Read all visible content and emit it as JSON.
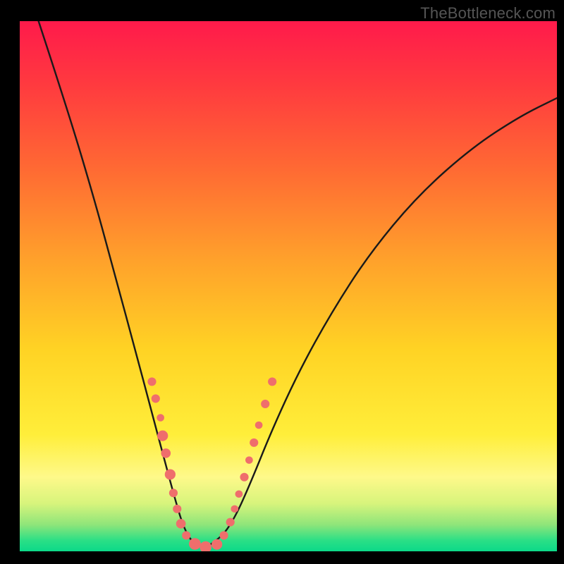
{
  "watermark": "TheBottleneck.com",
  "colors": {
    "dot_fill": "#ef6e6c",
    "curve_stroke": "#1a1a1a",
    "background_black": "#000000"
  },
  "chart_data": {
    "type": "line",
    "title": "",
    "xlabel": "",
    "ylabel": "",
    "xlim": [
      0,
      1
    ],
    "ylim": [
      0,
      1
    ],
    "note": "No axes, ticks, or numeric labels are visible. The plot shows two converging curves (a V-shaped bottleneck profile) over a vertical red→green gradient. Coordinates below are normalized to the visible plot area (0,0 = top-left, 1,1 = bottom-right).",
    "series": [
      {
        "name": "left-curve",
        "values": [
          {
            "x": 0.035,
            "y": 0.0
          },
          {
            "x": 0.09,
            "y": 0.17
          },
          {
            "x": 0.14,
            "y": 0.34
          },
          {
            "x": 0.18,
            "y": 0.49
          },
          {
            "x": 0.215,
            "y": 0.62
          },
          {
            "x": 0.245,
            "y": 0.735
          },
          {
            "x": 0.27,
            "y": 0.83
          },
          {
            "x": 0.29,
            "y": 0.905
          },
          {
            "x": 0.305,
            "y": 0.955
          },
          {
            "x": 0.322,
            "y": 0.985
          },
          {
            "x": 0.345,
            "y": 0.993
          }
        ]
      },
      {
        "name": "right-curve",
        "values": [
          {
            "x": 0.345,
            "y": 0.993
          },
          {
            "x": 0.372,
            "y": 0.978
          },
          {
            "x": 0.4,
            "y": 0.938
          },
          {
            "x": 0.43,
            "y": 0.87
          },
          {
            "x": 0.47,
            "y": 0.77
          },
          {
            "x": 0.52,
            "y": 0.66
          },
          {
            "x": 0.58,
            "y": 0.55
          },
          {
            "x": 0.65,
            "y": 0.44
          },
          {
            "x": 0.74,
            "y": 0.33
          },
          {
            "x": 0.84,
            "y": 0.24
          },
          {
            "x": 0.93,
            "y": 0.18
          },
          {
            "x": 1.0,
            "y": 0.145
          }
        ]
      }
    ],
    "points": [
      {
        "x": 0.246,
        "y": 0.68,
        "r": 8
      },
      {
        "x": 0.253,
        "y": 0.712,
        "r": 8
      },
      {
        "x": 0.262,
        "y": 0.748,
        "r": 7
      },
      {
        "x": 0.266,
        "y": 0.782,
        "r": 10
      },
      {
        "x": 0.272,
        "y": 0.815,
        "r": 9
      },
      {
        "x": 0.28,
        "y": 0.855,
        "r": 10
      },
      {
        "x": 0.286,
        "y": 0.89,
        "r": 8
      },
      {
        "x": 0.293,
        "y": 0.92,
        "r": 8
      },
      {
        "x": 0.3,
        "y": 0.948,
        "r": 9
      },
      {
        "x": 0.31,
        "y": 0.97,
        "r": 8
      },
      {
        "x": 0.326,
        "y": 0.986,
        "r": 11
      },
      {
        "x": 0.346,
        "y": 0.992,
        "r": 11
      },
      {
        "x": 0.367,
        "y": 0.987,
        "r": 10
      },
      {
        "x": 0.38,
        "y": 0.97,
        "r": 8
      },
      {
        "x": 0.392,
        "y": 0.945,
        "r": 8
      },
      {
        "x": 0.4,
        "y": 0.92,
        "r": 7
      },
      {
        "x": 0.408,
        "y": 0.892,
        "r": 7
      },
      {
        "x": 0.418,
        "y": 0.86,
        "r": 8
      },
      {
        "x": 0.427,
        "y": 0.828,
        "r": 7
      },
      {
        "x": 0.436,
        "y": 0.795,
        "r": 8
      },
      {
        "x": 0.445,
        "y": 0.762,
        "r": 7
      },
      {
        "x": 0.457,
        "y": 0.722,
        "r": 8
      },
      {
        "x": 0.47,
        "y": 0.68,
        "r": 8
      }
    ]
  }
}
